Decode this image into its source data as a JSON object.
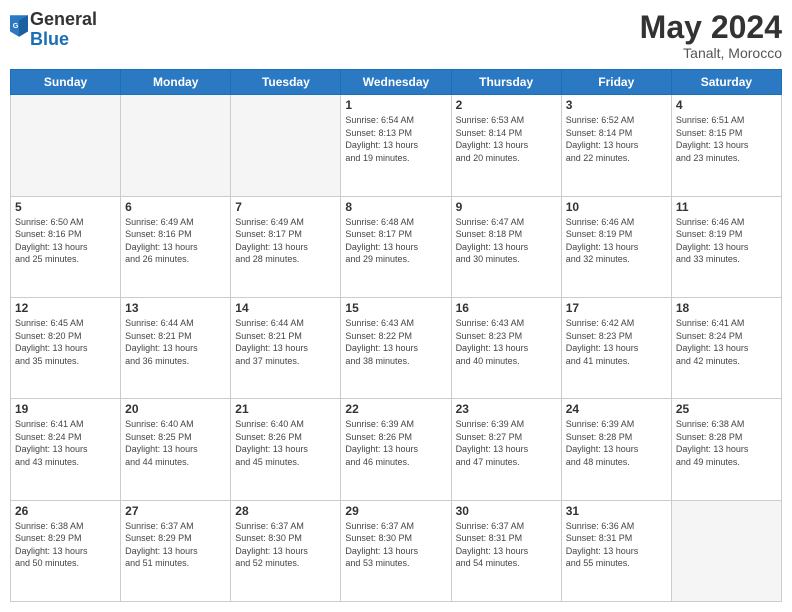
{
  "header": {
    "logo_general": "General",
    "logo_blue": "Blue",
    "month_title": "May 2024",
    "location": "Tanalt, Morocco"
  },
  "weekdays": [
    "Sunday",
    "Monday",
    "Tuesday",
    "Wednesday",
    "Thursday",
    "Friday",
    "Saturday"
  ],
  "weeks": [
    [
      {
        "day": "",
        "info": ""
      },
      {
        "day": "",
        "info": ""
      },
      {
        "day": "",
        "info": ""
      },
      {
        "day": "1",
        "info": "Sunrise: 6:54 AM\nSunset: 8:13 PM\nDaylight: 13 hours\nand 19 minutes."
      },
      {
        "day": "2",
        "info": "Sunrise: 6:53 AM\nSunset: 8:14 PM\nDaylight: 13 hours\nand 20 minutes."
      },
      {
        "day": "3",
        "info": "Sunrise: 6:52 AM\nSunset: 8:14 PM\nDaylight: 13 hours\nand 22 minutes."
      },
      {
        "day": "4",
        "info": "Sunrise: 6:51 AM\nSunset: 8:15 PM\nDaylight: 13 hours\nand 23 minutes."
      }
    ],
    [
      {
        "day": "5",
        "info": "Sunrise: 6:50 AM\nSunset: 8:16 PM\nDaylight: 13 hours\nand 25 minutes."
      },
      {
        "day": "6",
        "info": "Sunrise: 6:49 AM\nSunset: 8:16 PM\nDaylight: 13 hours\nand 26 minutes."
      },
      {
        "day": "7",
        "info": "Sunrise: 6:49 AM\nSunset: 8:17 PM\nDaylight: 13 hours\nand 28 minutes."
      },
      {
        "day": "8",
        "info": "Sunrise: 6:48 AM\nSunset: 8:17 PM\nDaylight: 13 hours\nand 29 minutes."
      },
      {
        "day": "9",
        "info": "Sunrise: 6:47 AM\nSunset: 8:18 PM\nDaylight: 13 hours\nand 30 minutes."
      },
      {
        "day": "10",
        "info": "Sunrise: 6:46 AM\nSunset: 8:19 PM\nDaylight: 13 hours\nand 32 minutes."
      },
      {
        "day": "11",
        "info": "Sunrise: 6:46 AM\nSunset: 8:19 PM\nDaylight: 13 hours\nand 33 minutes."
      }
    ],
    [
      {
        "day": "12",
        "info": "Sunrise: 6:45 AM\nSunset: 8:20 PM\nDaylight: 13 hours\nand 35 minutes."
      },
      {
        "day": "13",
        "info": "Sunrise: 6:44 AM\nSunset: 8:21 PM\nDaylight: 13 hours\nand 36 minutes."
      },
      {
        "day": "14",
        "info": "Sunrise: 6:44 AM\nSunset: 8:21 PM\nDaylight: 13 hours\nand 37 minutes."
      },
      {
        "day": "15",
        "info": "Sunrise: 6:43 AM\nSunset: 8:22 PM\nDaylight: 13 hours\nand 38 minutes."
      },
      {
        "day": "16",
        "info": "Sunrise: 6:43 AM\nSunset: 8:23 PM\nDaylight: 13 hours\nand 40 minutes."
      },
      {
        "day": "17",
        "info": "Sunrise: 6:42 AM\nSunset: 8:23 PM\nDaylight: 13 hours\nand 41 minutes."
      },
      {
        "day": "18",
        "info": "Sunrise: 6:41 AM\nSunset: 8:24 PM\nDaylight: 13 hours\nand 42 minutes."
      }
    ],
    [
      {
        "day": "19",
        "info": "Sunrise: 6:41 AM\nSunset: 8:24 PM\nDaylight: 13 hours\nand 43 minutes."
      },
      {
        "day": "20",
        "info": "Sunrise: 6:40 AM\nSunset: 8:25 PM\nDaylight: 13 hours\nand 44 minutes."
      },
      {
        "day": "21",
        "info": "Sunrise: 6:40 AM\nSunset: 8:26 PM\nDaylight: 13 hours\nand 45 minutes."
      },
      {
        "day": "22",
        "info": "Sunrise: 6:39 AM\nSunset: 8:26 PM\nDaylight: 13 hours\nand 46 minutes."
      },
      {
        "day": "23",
        "info": "Sunrise: 6:39 AM\nSunset: 8:27 PM\nDaylight: 13 hours\nand 47 minutes."
      },
      {
        "day": "24",
        "info": "Sunrise: 6:39 AM\nSunset: 8:28 PM\nDaylight: 13 hours\nand 48 minutes."
      },
      {
        "day": "25",
        "info": "Sunrise: 6:38 AM\nSunset: 8:28 PM\nDaylight: 13 hours\nand 49 minutes."
      }
    ],
    [
      {
        "day": "26",
        "info": "Sunrise: 6:38 AM\nSunset: 8:29 PM\nDaylight: 13 hours\nand 50 minutes."
      },
      {
        "day": "27",
        "info": "Sunrise: 6:37 AM\nSunset: 8:29 PM\nDaylight: 13 hours\nand 51 minutes."
      },
      {
        "day": "28",
        "info": "Sunrise: 6:37 AM\nSunset: 8:30 PM\nDaylight: 13 hours\nand 52 minutes."
      },
      {
        "day": "29",
        "info": "Sunrise: 6:37 AM\nSunset: 8:30 PM\nDaylight: 13 hours\nand 53 minutes."
      },
      {
        "day": "30",
        "info": "Sunrise: 6:37 AM\nSunset: 8:31 PM\nDaylight: 13 hours\nand 54 minutes."
      },
      {
        "day": "31",
        "info": "Sunrise: 6:36 AM\nSunset: 8:31 PM\nDaylight: 13 hours\nand 55 minutes."
      },
      {
        "day": "",
        "info": ""
      }
    ]
  ]
}
